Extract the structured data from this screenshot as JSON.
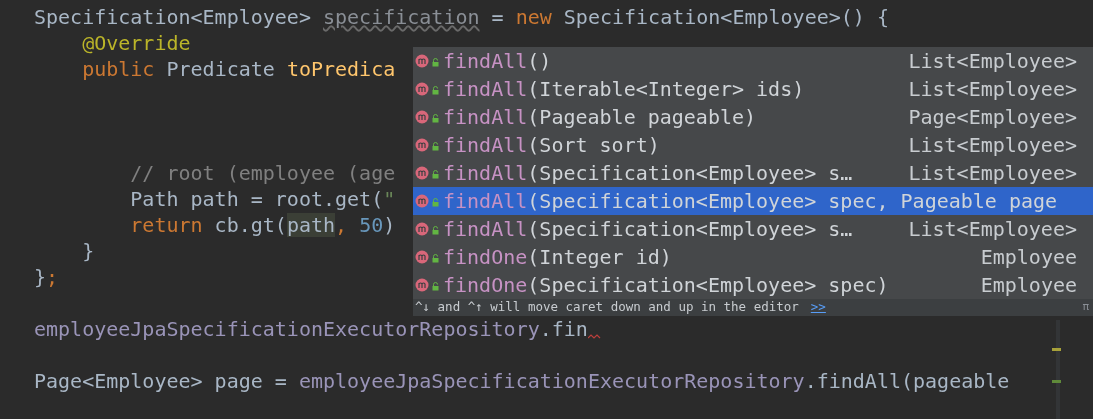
{
  "code_lines": [
    {
      "kind": "code",
      "tokens": [
        {
          "text": "Specification<Employee> ",
          "kind": "plain"
        },
        {
          "text": "specification",
          "kind": "unused"
        },
        {
          "text": " = ",
          "kind": "plain"
        },
        {
          "text": "new",
          "kind": "keyword"
        },
        {
          "text": " Specification<Employee>() {",
          "kind": "plain"
        }
      ]
    },
    {
      "kind": "code",
      "tokens": [
        {
          "text": "    @Override",
          "kind": "annotation"
        }
      ]
    },
    {
      "kind": "code",
      "tokens": [
        {
          "text": "    public",
          "kind": "keyword"
        },
        {
          "text": " Predicate ",
          "kind": "plain"
        },
        {
          "text": "toPredica",
          "kind": "method"
        }
      ]
    },
    {
      "kind": "blank"
    },
    {
      "kind": "blank"
    },
    {
      "kind": "blank"
    },
    {
      "kind": "code",
      "tokens": [
        {
          "text": "        // root (employee (age",
          "kind": "comment"
        }
      ]
    },
    {
      "kind": "code",
      "tokens": [
        {
          "text": "        Path path = root.get(",
          "kind": "plain"
        },
        {
          "text": "\"",
          "kind": "string"
        }
      ]
    },
    {
      "kind": "code",
      "tokens": [
        {
          "text": "        return",
          "kind": "keyword"
        },
        {
          "text": " cb.gt(",
          "kind": "plain"
        },
        {
          "text": "path",
          "kind": "highlight"
        },
        {
          "text": ", ",
          "kind": "keyword"
        },
        {
          "text": "50",
          "kind": "number"
        },
        {
          "text": ")",
          "kind": "plain"
        }
      ]
    },
    {
      "kind": "code",
      "tokens": [
        {
          "text": "    }",
          "kind": "plain"
        }
      ]
    },
    {
      "kind": "code",
      "tokens": [
        {
          "text": "}",
          "kind": "plain"
        },
        {
          "text": ";",
          "kind": "keyword"
        }
      ]
    },
    {
      "kind": "blank"
    },
    {
      "kind": "code",
      "error": true,
      "tokens": [
        {
          "text": "employeeJpaSpecificationExecutorRepository",
          "kind": "field"
        },
        {
          "text": ".fin",
          "kind": "plain"
        }
      ]
    },
    {
      "kind": "blank"
    },
    {
      "kind": "code",
      "tokens": [
        {
          "text": "Page<Employee> page = ",
          "kind": "plain"
        },
        {
          "text": "employeeJpaSpecificationExecutorRepository",
          "kind": "field"
        },
        {
          "text": ".findAll(pageable",
          "kind": "plain"
        }
      ]
    }
  ],
  "completion": {
    "items": [
      {
        "name": "findAll",
        "params": "()",
        "type": "List<Employee>",
        "selected": false
      },
      {
        "name": "findAll",
        "params": "(Iterable<Integer> ids)",
        "type": "List<Employee>",
        "selected": false
      },
      {
        "name": "findAll",
        "params": "(Pageable pageable)",
        "type": "Page<Employee>",
        "selected": false
      },
      {
        "name": "findAll",
        "params": "(Sort sort)",
        "type": "List<Employee>",
        "selected": false
      },
      {
        "name": "findAll",
        "params": "(Specification<Employee> s…",
        "type": "List<Employee>",
        "selected": false
      },
      {
        "name": "findAll",
        "params": "(Specification<Employee> spec, Pageable page",
        "selected": true
      },
      {
        "name": "findAll",
        "params": "(Specification<Employee> s…",
        "type": "List<Employee>",
        "selected": false
      },
      {
        "name": "findOne",
        "params": "(Integer id)",
        "type": "Employee",
        "selected": false
      },
      {
        "name": "findOne",
        "params": "(Specification<Employee> spec)",
        "type": "Employee",
        "selected": false
      }
    ],
    "hint": "^↓ and ^↑ will move caret down and up in the editor",
    "hint_link": ">>",
    "corner": "π"
  }
}
